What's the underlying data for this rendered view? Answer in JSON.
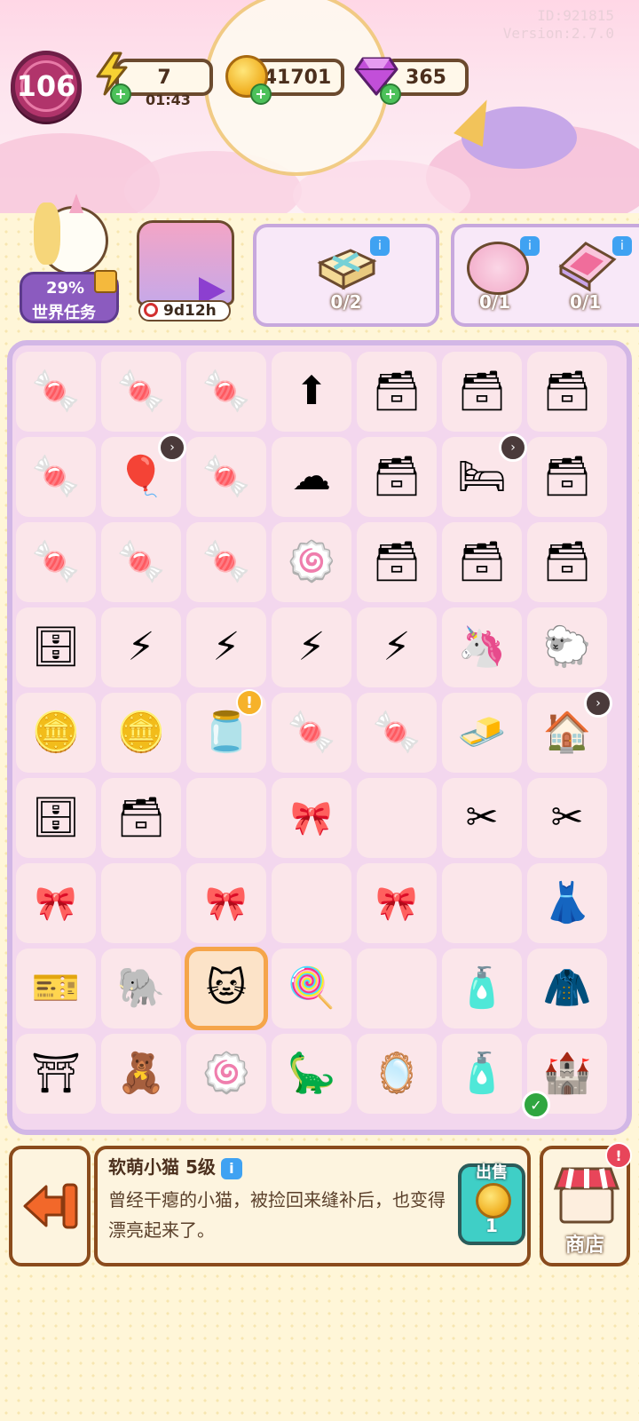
{
  "header": {
    "id_text": "ID:921815",
    "version_text": "Version:2.7.0",
    "level": "106",
    "energy": {
      "value": "7",
      "timer": "01:43",
      "icon": "lightning-icon"
    },
    "coins": {
      "value": "41701",
      "icon": "coin-icon"
    },
    "gems": {
      "value": "365",
      "icon": "gem-icon"
    }
  },
  "world_task": {
    "percent": "29%",
    "label": "世界任务"
  },
  "event": {
    "timer": "9d12h"
  },
  "orders": [
    {
      "icon": "gift-box-icon",
      "progress": "0/2"
    },
    {
      "icon": "macaron-box-icon",
      "progress": "0/1"
    },
    {
      "icon": "compact-mirror-icon",
      "progress": "0/1"
    }
  ],
  "board": {
    "rows": [
      [
        {
          "n": "candy-bag",
          "e": "🍬"
        },
        {
          "n": "candy-bag",
          "e": "🍬"
        },
        {
          "n": "candy-bag",
          "e": "🍬"
        },
        {
          "n": "upgrade-card",
          "e": "⬆"
        },
        {
          "n": "drawer",
          "e": "🗃"
        },
        {
          "n": "drawer",
          "e": "🗃"
        },
        {
          "n": "drawer",
          "e": "🗃"
        }
      ],
      [
        {
          "n": "candy-bag",
          "e": "🍬"
        },
        {
          "n": "balloons",
          "e": "🎈",
          "badge": "›"
        },
        {
          "n": "candy-bag",
          "e": "🍬"
        },
        {
          "n": "cotton-candy",
          "e": "☁"
        },
        {
          "n": "drawer",
          "e": "🗃"
        },
        {
          "n": "bed",
          "e": "🛏",
          "badge": "›"
        },
        {
          "n": "drawer",
          "e": "🗃"
        }
      ],
      [
        {
          "n": "candy-bag",
          "e": "🍬"
        },
        {
          "n": "candy-bag",
          "e": "🍬"
        },
        {
          "n": "candy-bag",
          "e": "🍬"
        },
        {
          "n": "marshmallow",
          "e": "🍥"
        },
        {
          "n": "drawer",
          "e": "🗃"
        },
        {
          "n": "drawer",
          "e": "🗃"
        },
        {
          "n": "drawer",
          "e": "🗃"
        }
      ],
      [
        {
          "n": "cabinet",
          "e": "🗄"
        },
        {
          "n": "energy-jar",
          "e": "⚡"
        },
        {
          "n": "energy-jar",
          "e": "⚡"
        },
        {
          "n": "energy-jar",
          "e": "⚡"
        },
        {
          "n": "energy-jar",
          "e": "⚡"
        },
        {
          "n": "unicorn-plush",
          "e": "🦄"
        },
        {
          "n": "sheep-plush",
          "e": "🐑"
        }
      ],
      [
        {
          "n": "coin-pile",
          "e": "🪙"
        },
        {
          "n": "coin-stack",
          "e": "🪙"
        },
        {
          "n": "glass-jar",
          "e": "🫙",
          "excl": "!"
        },
        {
          "n": "candy-bag",
          "e": "🍬"
        },
        {
          "n": "candy-bag",
          "e": "🍬"
        },
        {
          "n": "butter-box",
          "e": "🧈"
        },
        {
          "n": "shop-house",
          "e": "🏠",
          "badge": "›"
        }
      ],
      [
        {
          "n": "nightstand",
          "e": "🗄"
        },
        {
          "n": "drawer",
          "e": "🗃"
        },
        {
          "n": "empty",
          "e": ""
        },
        {
          "n": "locked",
          "e": "🎀",
          "lock": true
        },
        {
          "n": "empty",
          "e": ""
        },
        {
          "n": "sewing-kit",
          "e": "✂"
        },
        {
          "n": "sewing-kit",
          "e": "✂"
        }
      ],
      [
        {
          "n": "locked",
          "e": "🎀",
          "lock": true
        },
        {
          "n": "empty",
          "e": ""
        },
        {
          "n": "locked",
          "e": "🎀",
          "lock": true
        },
        {
          "n": "empty",
          "e": ""
        },
        {
          "n": "locked",
          "e": "🎀",
          "lock": true
        },
        {
          "n": "empty",
          "e": ""
        },
        {
          "n": "dress",
          "e": "👗"
        }
      ],
      [
        {
          "n": "ticket",
          "e": "🎫"
        },
        {
          "n": "elephant-plush",
          "e": "🐘"
        },
        {
          "n": "cat-plush",
          "e": "🐱",
          "selected": true
        },
        {
          "n": "lollipop",
          "e": "🍭"
        },
        {
          "n": "empty",
          "e": ""
        },
        {
          "n": "lint-roller",
          "e": "🧴"
        },
        {
          "n": "jacket",
          "e": "🧥"
        }
      ],
      [
        {
          "n": "gate",
          "e": "⛩"
        },
        {
          "n": "bear-plush",
          "e": "🧸"
        },
        {
          "n": "marshmallow",
          "e": "🍥"
        },
        {
          "n": "dinosaur-plush",
          "e": "🦕"
        },
        {
          "n": "hand-mirror",
          "e": "🪞"
        },
        {
          "n": "cosmetics",
          "e": "🧴"
        },
        {
          "n": "castle",
          "e": "🏰",
          "check": true
        }
      ]
    ]
  },
  "info": {
    "title": "软萌小猫 5级",
    "description": "曾经干瘪的小猫，被捡回来缝补后，也变得漂亮起来了。",
    "sell_label": "出售",
    "sell_value": "1"
  },
  "shop": {
    "label": "商店"
  }
}
